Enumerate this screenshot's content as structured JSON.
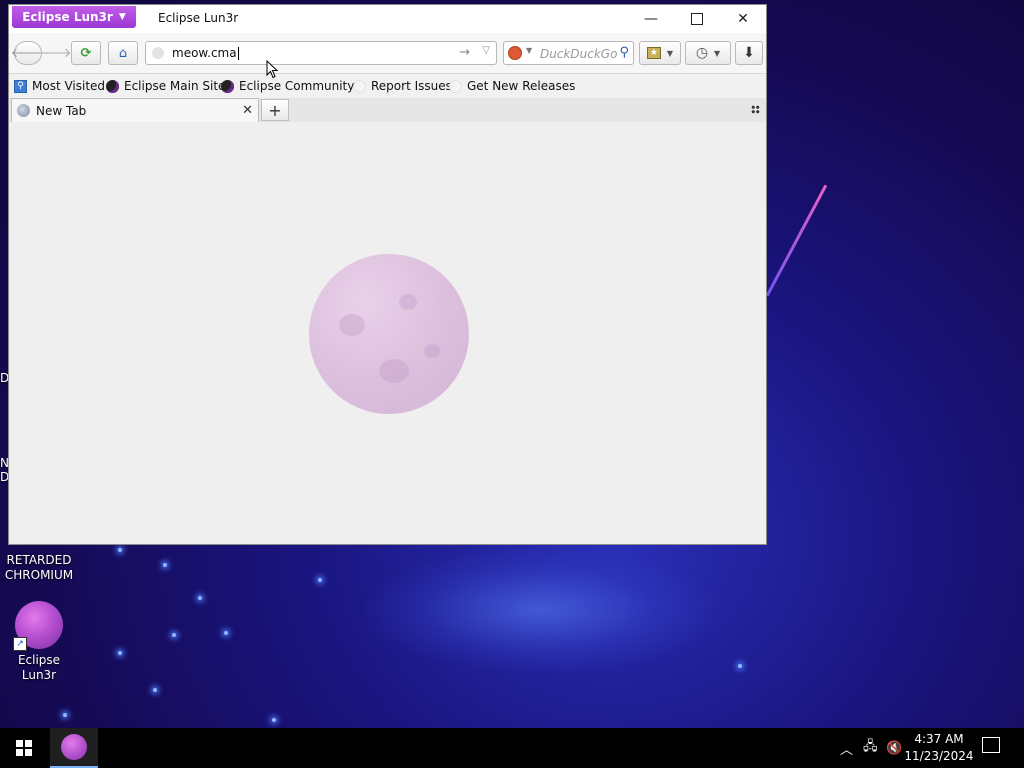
{
  "window": {
    "app_menu_label": "Eclipse Lun3r",
    "title": "Eclipse Lun3r"
  },
  "navbar": {
    "url_value": "meow.cma",
    "search_placeholder": "DuckDuckGo"
  },
  "bookmarks": [
    {
      "label": "Most Visited"
    },
    {
      "label": "Eclipse Main Site"
    },
    {
      "label": "Eclipse Community"
    },
    {
      "label": "Report Issues"
    },
    {
      "label": "Get New Releases"
    }
  ],
  "tabs": [
    {
      "label": "New Tab"
    }
  ],
  "desktop": {
    "icons": [
      {
        "label": "RETARDED CHROMIUM"
      },
      {
        "label": "Eclipse Lun3r"
      }
    ],
    "edge_fragments": [
      "D",
      "N",
      "D"
    ]
  },
  "taskbar": {
    "time": "4:37 AM",
    "date": "11/23/2024"
  },
  "colors": {
    "accent": "#a845dc",
    "desktop_bg": "#160a55"
  }
}
